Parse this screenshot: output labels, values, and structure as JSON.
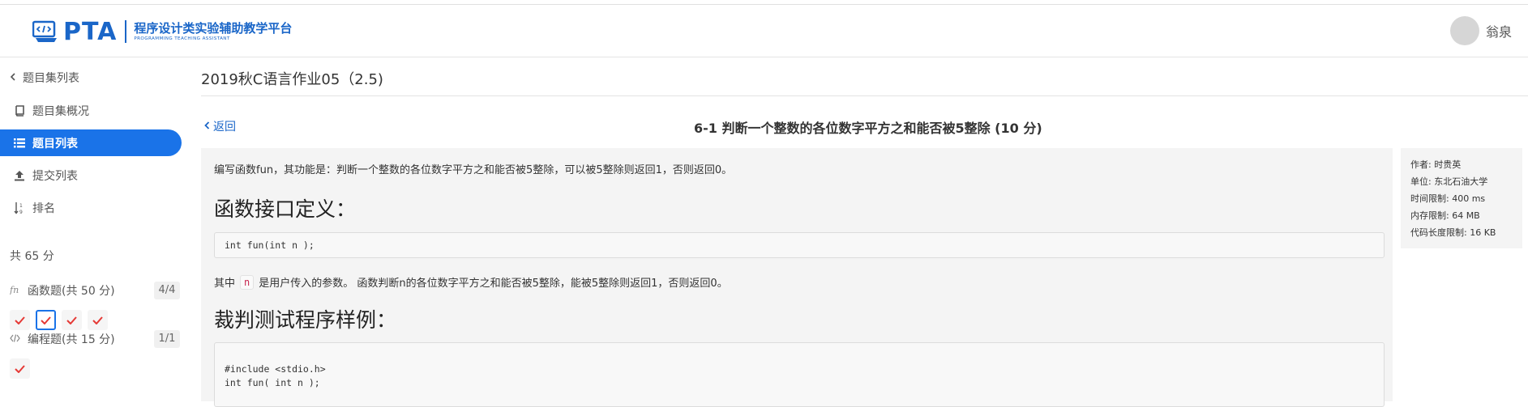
{
  "header": {
    "logo_text": "PTA",
    "logo_cn": "程序设计类实验辅助教学平台",
    "logo_en": "PROGRAMMING TEACHING ASSISTANT",
    "user_name": "翁泉"
  },
  "sidebar": {
    "back_label": "题目集列表",
    "nav": [
      {
        "label": "题目集概况",
        "icon": "book-icon"
      },
      {
        "label": "题目列表",
        "icon": "list-icon",
        "active": true
      },
      {
        "label": "提交列表",
        "icon": "upload-icon"
      },
      {
        "label": "排名",
        "icon": "sort-icon"
      }
    ],
    "total_score": "共 65 分",
    "groups": [
      {
        "label": "函数题(共 50 分)",
        "icon": "function-icon",
        "count": "4/4",
        "checks": 4
      },
      {
        "label": "编程题(共 15 分)",
        "icon": "code-icon",
        "count": "1/1",
        "checks": 1
      }
    ]
  },
  "main": {
    "set_title": "2019秋C语言作业05（2.5)",
    "back_label": "返回",
    "problem_title": "6-1 判断一个整数的各位数字平方之和能否被5整除 (10 分)",
    "description": "编写函数fun，其功能是：判断一个整数的各位数字平方之和能否被5整除，可以被5整除则返回1，否则返回0。",
    "section_interface": "函数接口定义：",
    "interface_code": "int fun(int n );",
    "note_before": "其中",
    "note_code": "n",
    "note_after": "是用户传入的参数。 函数判断n的各位数字平方之和能否被5整除，能被5整除则返回1，否则返回0。",
    "section_sample": "裁判测试程序样例：",
    "sample_code_line1": "#include <stdio.h>",
    "sample_code_line2": "int fun( int n );"
  },
  "meta": {
    "author": "作者: 时贵英",
    "unit": "单位: 东北石油大学",
    "time_limit": "时间限制: 400 ms",
    "memory_limit": "内存限制: 64 MB",
    "code_limit": "代码长度限制: 16 KB"
  },
  "colors": {
    "accent": "#1a73e8",
    "logo": "#1a66c8",
    "check": "#e53935"
  }
}
